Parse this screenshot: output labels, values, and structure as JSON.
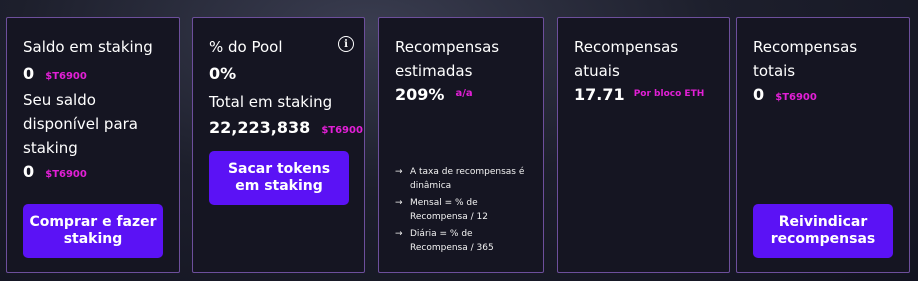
{
  "cards": {
    "balance": {
      "title": "Saldo em staking",
      "value": "0",
      "unit": "$T6900",
      "available_label": "Seu saldo disponível para staking",
      "available_value": "0",
      "available_unit": "$T6900",
      "button_label": "Comprar e fazer staking"
    },
    "pool": {
      "title": "% do Pool",
      "info_icon": "i",
      "value": "0%",
      "total_label": "Total em staking",
      "total_value": "22,223,838",
      "total_unit": "$T6900",
      "button_label": "Sacar tokens em staking"
    },
    "estimated": {
      "title": "Recompensas estimadas",
      "value": "209%",
      "unit": "a/a",
      "arrow": "→",
      "notes": [
        "A taxa de recompensas é dinâmica",
        "Mensal = % de Recompensa / 12",
        "Diária = % de Recompensa / 365"
      ]
    },
    "current": {
      "title": "Recompensas atuais",
      "value": "17.71",
      "unit": "Por bloco ETH"
    },
    "total": {
      "title": "Recompensas totais",
      "value": "0",
      "unit": "$T6900",
      "button_label": "Reivindicar recompensas"
    }
  },
  "colors": {
    "card_background": "#151522",
    "card_border": "#6d4f9c",
    "button": "#5b12f5",
    "accent_unit": "#e21fd6"
  }
}
